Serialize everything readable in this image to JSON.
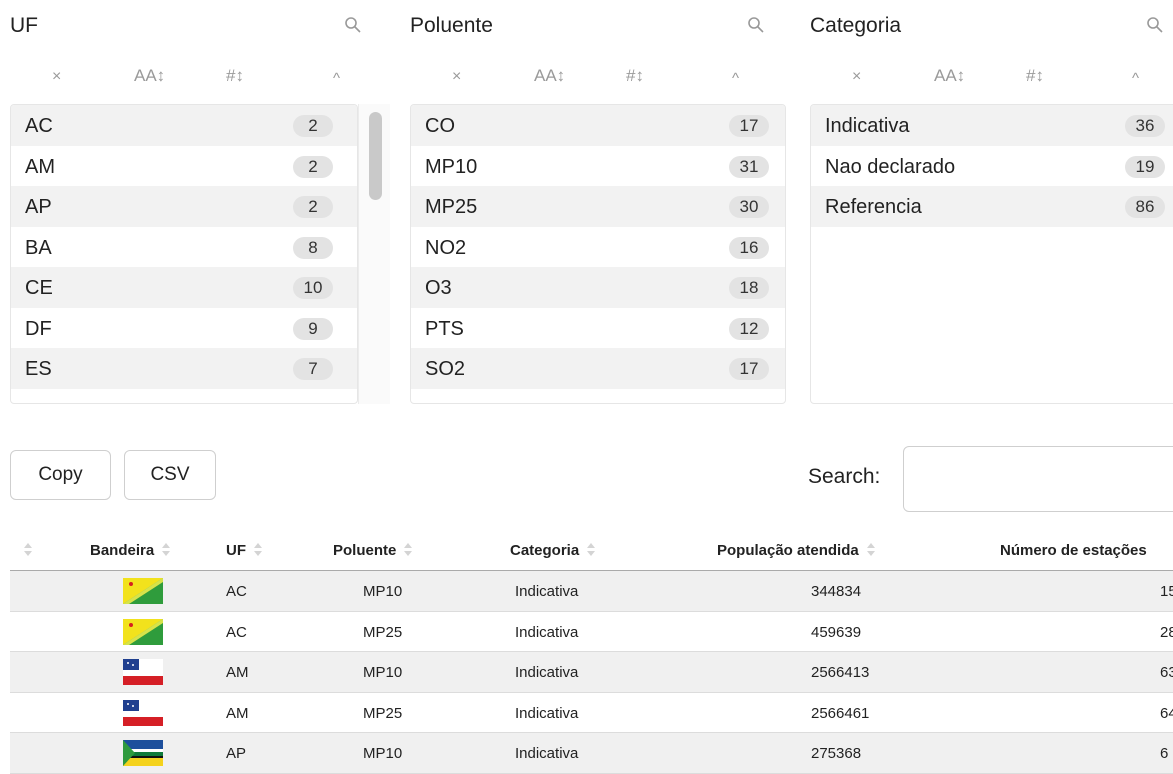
{
  "filters": [
    {
      "title": "UF",
      "sort_clear": "×",
      "sort_alpha": "AA↕",
      "sort_num": "#↕",
      "collapse": "^",
      "items": [
        {
          "label": "AC",
          "count": "2"
        },
        {
          "label": "AM",
          "count": "2"
        },
        {
          "label": "AP",
          "count": "2"
        },
        {
          "label": "BA",
          "count": "8"
        },
        {
          "label": "CE",
          "count": "10"
        },
        {
          "label": "DF",
          "count": "9"
        },
        {
          "label": "ES",
          "count": "7"
        }
      ]
    },
    {
      "title": "Poluente",
      "sort_clear": "×",
      "sort_alpha": "AA↕",
      "sort_num": "#↕",
      "collapse": "^",
      "items": [
        {
          "label": "CO",
          "count": "17"
        },
        {
          "label": "MP10",
          "count": "31"
        },
        {
          "label": "MP25",
          "count": "30"
        },
        {
          "label": "NO2",
          "count": "16"
        },
        {
          "label": "O3",
          "count": "18"
        },
        {
          "label": "PTS",
          "count": "12"
        },
        {
          "label": "SO2",
          "count": "17"
        }
      ]
    },
    {
      "title": "Categoria",
      "sort_clear": "×",
      "sort_alpha": "AA↕",
      "sort_num": "#↕",
      "collapse": "^",
      "items": [
        {
          "label": "Indicativa",
          "count": "36"
        },
        {
          "label": "Nao declarado",
          "count": "19"
        },
        {
          "label": "Referencia",
          "count": "86"
        }
      ]
    }
  ],
  "buttons": {
    "copy": "Copy",
    "csv": "CSV"
  },
  "search": {
    "label": "Search:",
    "value": ""
  },
  "table": {
    "columns": [
      "Bandeira",
      "UF",
      "Poluente",
      "Categoria",
      "População atendida",
      "Número de estações"
    ],
    "rows": [
      {
        "flag": "flag-ac",
        "uf": "AC",
        "poluente": "MP10",
        "categoria": "Indicativa",
        "populacao": "344834",
        "estacoes": "15"
      },
      {
        "flag": "flag-ac",
        "uf": "AC",
        "poluente": "MP25",
        "categoria": "Indicativa",
        "populacao": "459639",
        "estacoes": "28"
      },
      {
        "flag": "flag-am",
        "uf": "AM",
        "poluente": "MP10",
        "categoria": "Indicativa",
        "populacao": "2566413",
        "estacoes": "63"
      },
      {
        "flag": "flag-am",
        "uf": "AM",
        "poluente": "MP25",
        "categoria": "Indicativa",
        "populacao": "2566461",
        "estacoes": "64"
      },
      {
        "flag": "flag-ap",
        "uf": "AP",
        "poluente": "MP10",
        "categoria": "Indicativa",
        "populacao": "275368",
        "estacoes": "6"
      }
    ]
  },
  "colors": {
    "row_stripe": "#f0f0f0",
    "badge": "#e3e3e3",
    "border": "#cfcfcf"
  }
}
